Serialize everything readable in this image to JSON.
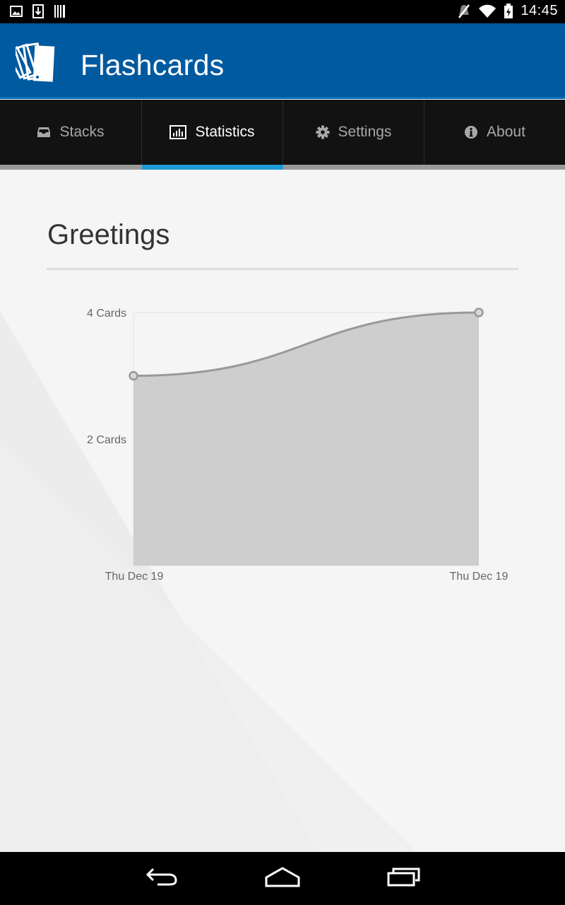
{
  "status_bar": {
    "time": "14:45",
    "left_icons": [
      "image-icon",
      "download-icon",
      "barcode-icon"
    ],
    "right_icons": [
      "mute-icon",
      "wifi-icon",
      "battery-charging-icon"
    ]
  },
  "app_bar": {
    "title": "Flashcards",
    "logo_icon": "flashcards-logo-icon",
    "color": "#005aa0"
  },
  "tabs": [
    {
      "label": "Stacks",
      "icon": "inbox-icon",
      "active": false
    },
    {
      "label": "Statistics",
      "icon": "bar-chart-icon",
      "active": true
    },
    {
      "label": "Settings",
      "icon": "gear-icon",
      "active": false
    },
    {
      "label": "About",
      "icon": "info-icon",
      "active": false
    }
  ],
  "accent_color": "#1f9bd7",
  "stack": {
    "title": "Greetings"
  },
  "chart_data": {
    "type": "area",
    "x": [
      "Thu Dec 19",
      "Thu Dec 19"
    ],
    "series": [
      {
        "values": [
          3,
          4
        ]
      }
    ],
    "y_ticks": [
      "2 Cards",
      "4 Cards"
    ],
    "ylim": [
      0,
      4
    ],
    "fill_color": "#cecece",
    "line_color": "#999999",
    "smooth": true
  },
  "nav_bar": {
    "buttons": [
      "back-icon",
      "home-icon",
      "recent-apps-icon"
    ]
  }
}
